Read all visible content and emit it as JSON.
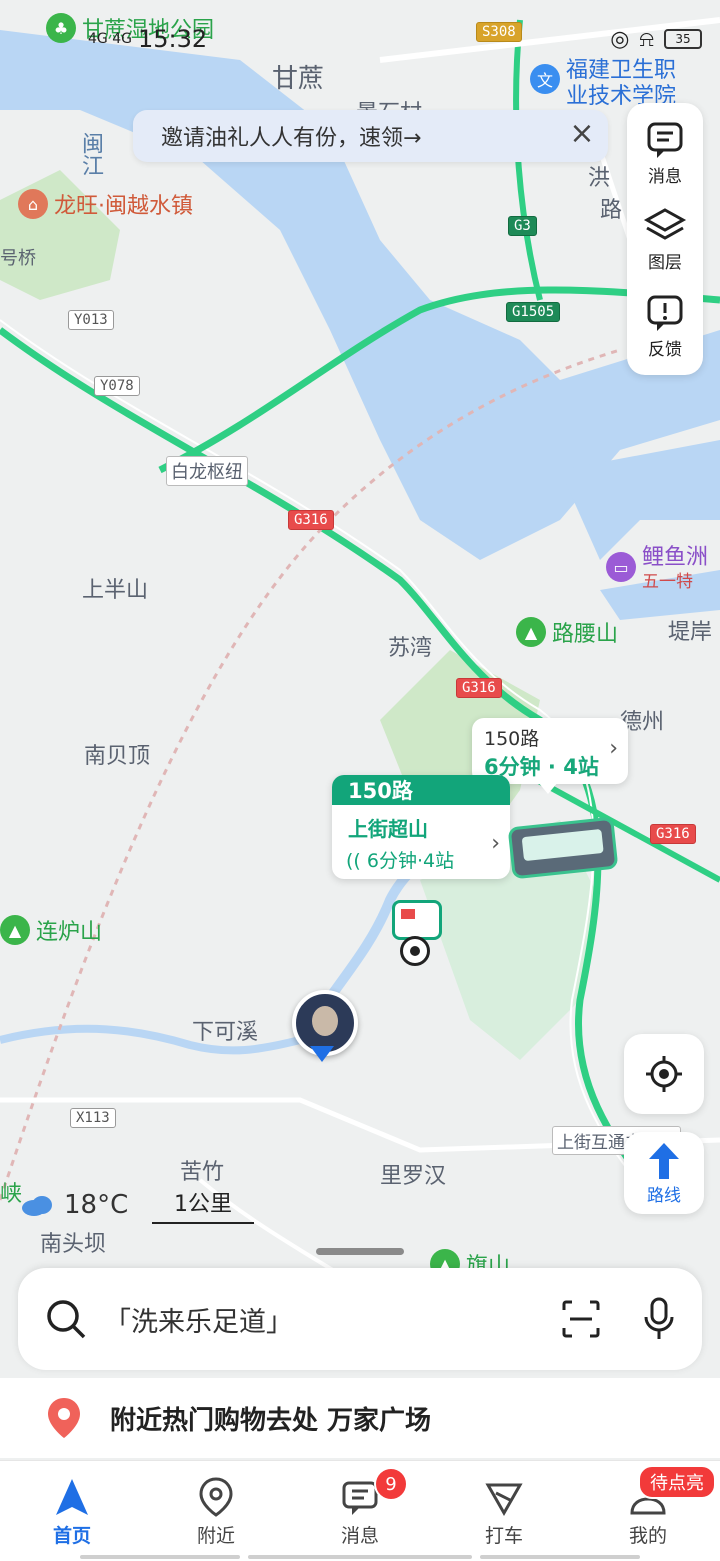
{
  "status_bar": {
    "network": "4G 4G",
    "time": "15:32",
    "battery": "35"
  },
  "banner": {
    "text": "邀请油礼人人有份，速领→"
  },
  "right_panel": {
    "messages": "消息",
    "layers": "图层",
    "feedback": "反馈"
  },
  "route_button": {
    "label": "路线"
  },
  "map": {
    "labels": {
      "ganzhe": "甘蔗",
      "jingshi": "景石村",
      "minjiang": "闽江",
      "haoqiao": "号桥",
      "bailong": "白龙枢纽",
      "shangbanshan": "上半山",
      "suwan": "苏湾",
      "nanbeiding": "南贝顶",
      "xiakexi": "下可溪",
      "kuzhu": "苦竹",
      "liluohan": "里罗汉",
      "nantouba": "南头坝",
      "dezhou": "德州",
      "dian": "堤岸",
      "xia": "峡",
      "hong": "洪",
      "lu": "路",
      "interchange": "上街互通立交桥"
    },
    "pois": {
      "park": "甘蔗湿地公园",
      "college_1": "福建卫生职",
      "college_2": "业技术学院",
      "longwang": "龙旺·闽越水镇",
      "liyuzhou": "鲤鱼洲",
      "liyuzhou_sub": "五一特",
      "luyaoshan": "路腰山",
      "lianlushan": "连炉山",
      "qishan": "旗山"
    },
    "roads": {
      "s308": "S308",
      "g3": "G3",
      "g1505": "G1505",
      "y013": "Y013",
      "y078": "Y078",
      "g316a": "G316",
      "g316b": "G316",
      "g316c": "G316",
      "x113": "X113"
    }
  },
  "bus": {
    "small": {
      "route": "150路",
      "eta": "6分钟 · 4站"
    },
    "main": {
      "route": "150路",
      "stop": "上街超山",
      "eta": "6分钟·4站"
    }
  },
  "weather": {
    "temp": "18°C"
  },
  "scale": {
    "label": "1公里"
  },
  "search": {
    "placeholder": "「洗来乐足道」"
  },
  "suggestion": {
    "text": "附近热门购物去处 万家广场"
  },
  "bottom_nav": {
    "items": [
      {
        "label": "首页"
      },
      {
        "label": "附近"
      },
      {
        "label": "消息"
      },
      {
        "label": "打车"
      },
      {
        "label": "我的"
      }
    ],
    "message_badge": "9",
    "mine_badge": "待点亮"
  },
  "colors": {
    "accent": "#1f6fe5",
    "bus_green": "#12a57a",
    "highway": "#2fcf84",
    "water": "#b9d6f4"
  }
}
